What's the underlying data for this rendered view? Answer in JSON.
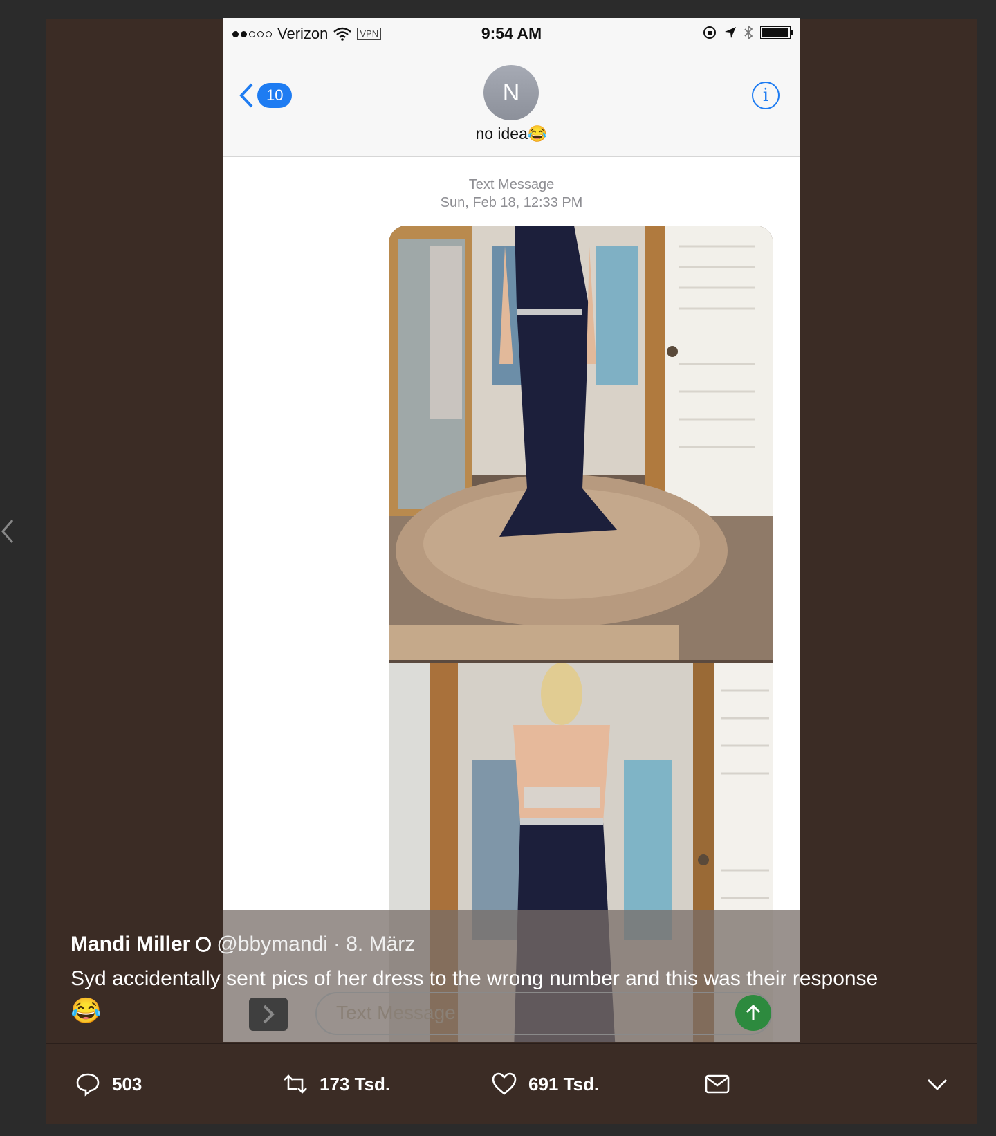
{
  "phone": {
    "status_bar": {
      "carrier": "Verizon",
      "vpn": "VPN",
      "time": "9:54 AM",
      "signal_dots": [
        true,
        true,
        false,
        false,
        false
      ]
    },
    "nav": {
      "back_count": "10",
      "avatar_initial": "N",
      "contact_name": "no idea😂"
    },
    "message": {
      "type_label": "Text Message",
      "timestamp": "Sun, Feb 18, 12:33 PM"
    },
    "composer": {
      "placeholder": "Text Message"
    }
  },
  "tweet": {
    "name": "Mandi Miller",
    "handle": "@bbymandi",
    "date": "· 8. März",
    "text": "Syd accidentally sent pics of her dress to the wrong number and this was their response",
    "emoji": "😂",
    "actions": {
      "replies": "503",
      "retweets": "173 Tsd.",
      "likes": "691 Tsd."
    }
  },
  "colors": {
    "background": "#2b2b2b",
    "frame": "#3b2c25",
    "ios_blue": "#1e7cf2",
    "send_green": "#2d8a3e"
  }
}
